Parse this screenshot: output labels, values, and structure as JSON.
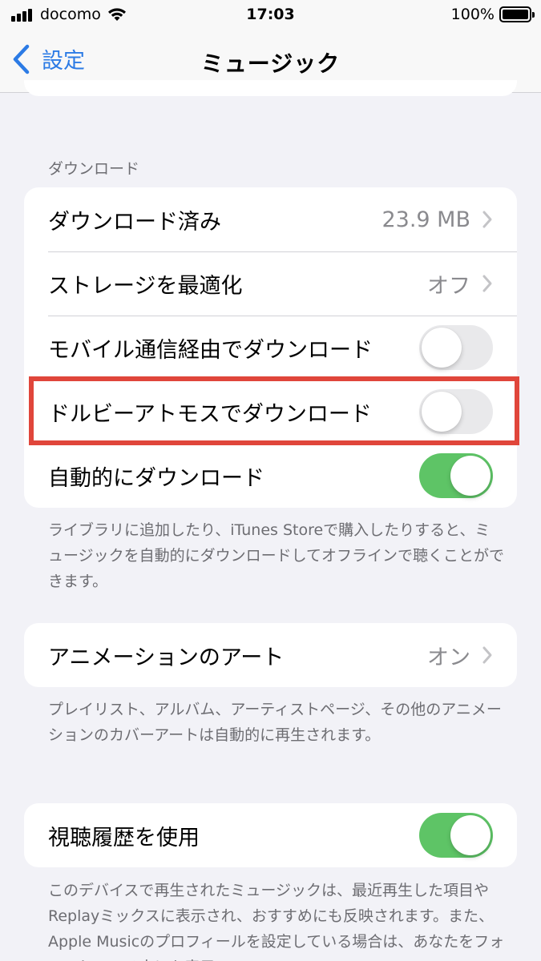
{
  "status_bar": {
    "carrier": "docomo",
    "time": "17:03",
    "battery": "100%"
  },
  "nav": {
    "back_label": "設定",
    "title": "ミュージック"
  },
  "downloads": {
    "header": "ダウンロード",
    "rows": [
      {
        "label": "ダウンロード済み",
        "value": "23.9 MB"
      },
      {
        "label": "ストレージを最適化",
        "value": "オフ"
      },
      {
        "label": "モバイル通信経由でダウンロード",
        "toggle": false
      },
      {
        "label": "ドルビーアトモスでダウンロード",
        "toggle": false
      },
      {
        "label": "自動的にダウンロード",
        "toggle": true
      }
    ],
    "footer": "ライブラリに追加したり、iTunes Storeで購入したりすると、ミュージックを自動的にダウンロードしてオフラインで聴くことができます。"
  },
  "animation": {
    "label": "アニメーションのアート",
    "value": "オン",
    "footer": "プレイリスト、アルバム、アーティストページ、その他のアニメーションのカバーアートは自動的に再生されます。"
  },
  "history": {
    "label": "視聴履歴を使用",
    "toggle": true,
    "footer": "このデバイスで再生されたミュージックは、最近再生した項目やReplayミックスに表示され、おすすめにも反映されます。また、Apple Musicのプロフィールを設定している場合は、あなたをフォローしている人にも表示"
  },
  "colors": {
    "accent": "#2c7be5",
    "toggle_on": "#5ec466",
    "highlight": "#e0463b"
  }
}
